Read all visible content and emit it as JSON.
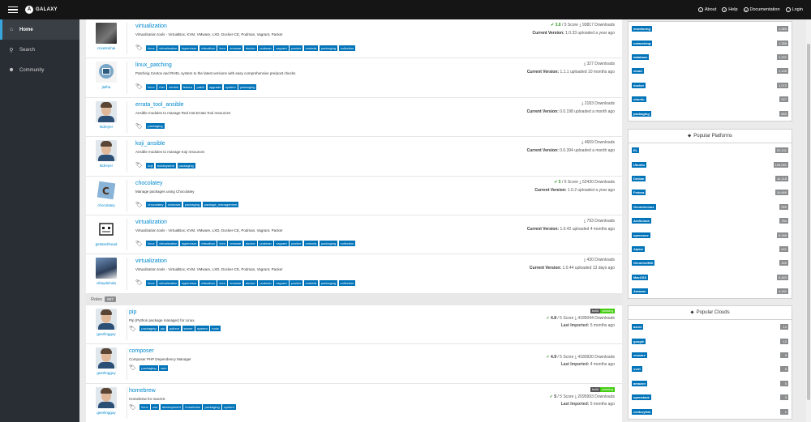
{
  "topbar": {
    "brand": "GALAXY",
    "nav": [
      {
        "label": "About",
        "icon": "info-circle-icon",
        "glyph": "i"
      },
      {
        "label": "Help",
        "icon": "question-circle-icon",
        "glyph": "?"
      },
      {
        "label": "Documentation",
        "icon": "book-icon",
        "glyph": "▭"
      },
      {
        "label": "Login",
        "icon": "login-icon",
        "glyph": "→"
      }
    ]
  },
  "sidebar": {
    "items": [
      {
        "label": "Home",
        "icon": "home-icon",
        "glyph": "⌂"
      },
      {
        "label": "Search",
        "icon": "search-icon",
        "glyph": "⚲"
      },
      {
        "label": "Community",
        "icon": "community-icon",
        "glyph": "☻"
      }
    ]
  },
  "collections": [
    {
      "name": "virtualization",
      "owner": "crivetimihai",
      "desc": "Virtualization tools - VirtualBox, KVM, VMware, LXD, Docker-CE, Podman, Vagrant, Packer",
      "score": "3.8",
      "score_max": "5 Score",
      "downloads": "93817 Downloads",
      "version_label": "Current Version:",
      "version": "1.0.33 uploaded a year ago",
      "tags": [
        "linux",
        "virtualization",
        "hypervisor",
        "virtualbox",
        "kvm",
        "vmware",
        "docker",
        "podman",
        "vagrant",
        "packer",
        "xmlsrds",
        "packaging",
        "collection"
      ],
      "avatar": "dark"
    },
    {
      "name": "linux_patching",
      "owner": "jtalha",
      "desc": "Patching Centos and RHEL system to the latest versions with easy comprehensive pre/post checks",
      "score": "",
      "score_max": "",
      "downloads": "327 Downloads",
      "version_label": "Current Version:",
      "version": "1.1.1 uploaded 10 months ago",
      "tags": [
        "linux",
        "rhel",
        "centos",
        "fedora",
        "patch",
        "upgrade",
        "system",
        "packaging"
      ],
      "avatar": "logo"
    },
    {
      "name": "errata_tool_ansible",
      "owner": "ktdreyer",
      "desc": "Ansible modules to manage Red Hat Errata Tool resources",
      "score": "",
      "score_max": "",
      "downloads": "2183 Downloads",
      "version_label": "Current Version:",
      "version": "0.0.198 uploaded a month ago",
      "tags": [
        "packaging"
      ],
      "avatar": "face"
    },
    {
      "name": "koji_ansible",
      "owner": "ktdreyer",
      "desc": "Ansible modules to manage Koji resources",
      "score": "",
      "score_max": "",
      "downloads": "4669 Downloads",
      "version_label": "Current Version:",
      "version": "0.0.394 uploaded a month ago",
      "tags": [
        "koji",
        "buildsystem",
        "packaging"
      ],
      "avatar": "face"
    },
    {
      "name": "chocolatey",
      "owner": "chocolatey",
      "desc": "Manage packages using Chocolatey",
      "score": "5",
      "score_max": "5 Score",
      "downloads": "62430 Downloads",
      "version_label": "Current Version:",
      "version": "1.0.2 uploaded a year ago",
      "tags": [
        "chocolatey",
        "windows",
        "packaging",
        "package_management"
      ],
      "avatar": "choco"
    },
    {
      "name": "virtualization",
      "owner": "getstackhead",
      "desc": "Virtualization tools - VirtualBox, KVM, VMware, LXD, Docker-CE, Podman, Vagrant, Packer",
      "score": "",
      "score_max": "",
      "downloads": "793 Downloads",
      "version_label": "Current Version:",
      "version": "1.0.42 uploaded 4 months ago",
      "tags": [
        "linux",
        "virtualization",
        "hypervisor",
        "virtualbox",
        "kvm",
        "vmware",
        "docker",
        "podman",
        "vagrant",
        "packer",
        "xmlsrds",
        "packaging",
        "collection"
      ],
      "avatar": "robot"
    },
    {
      "name": "virtualization",
      "owner": "vikaydeloda",
      "desc": "Virtualization tools - VirtualBox, KVM, VMware, LXD, Docker-CE, Podman, Vagrant, Packer",
      "score": "",
      "score_max": "",
      "downloads": "430 Downloads",
      "version_label": "Current Version:",
      "version": "1.0.44 uploaded 13 days ago",
      "tags": [
        "linux",
        "virtualization",
        "hypervisor",
        "virtualbox",
        "kvm",
        "vmware",
        "docker",
        "podman",
        "vagrant",
        "packer",
        "xmlsrds",
        "packaging",
        "collection"
      ],
      "avatar": "scene"
    }
  ],
  "roles_section": {
    "label": "Roles",
    "count": "867"
  },
  "roles": [
    {
      "name": "pip",
      "owner": "geerlingguy",
      "desc": "Pip (Python package manager) for Linux.",
      "score": "4.8",
      "score_max": "5 Score",
      "downloads": "4185044 Downloads",
      "imported_label": "Last Imported:",
      "imported": "5 months ago",
      "badge": true,
      "badge_l": "build",
      "badge_r": "passing",
      "tags": [
        "packaging",
        "pip",
        "python",
        "server",
        "system",
        "tools"
      ]
    },
    {
      "name": "composer",
      "owner": "geerlingguy",
      "desc": "Composer PHP Dependency Manager",
      "score": "4.9",
      "score_max": "5 Score",
      "downloads": "4180930 Downloads",
      "imported_label": "Last Imported:",
      "imported": "4 months ago",
      "badge": false,
      "badge_l": "",
      "badge_r": "",
      "tags": [
        "packaging",
        "web"
      ]
    },
    {
      "name": "homebrew",
      "owner": "geerlingguy",
      "desc": "Homebrew for macOS",
      "score": "5",
      "score_max": "5 Score",
      "downloads": "2095993 Downloads",
      "imported_label": "Last Imported:",
      "imported": "5 months ago",
      "badge": true,
      "badge_l": "build",
      "badge_r": "passing",
      "tags": [
        "linux",
        "osx",
        "development",
        "homebrew",
        "packaging",
        "system"
      ]
    }
  ],
  "tags_panel": {
    "items": [
      {
        "label": "monitoring",
        "count": "1,369"
      },
      {
        "label": "networking",
        "count": "1,358"
      },
      {
        "label": "database",
        "count": "1,201"
      },
      {
        "label": "cloud",
        "count": "1,105"
      },
      {
        "label": "docker",
        "count": "1,072"
      },
      {
        "label": "ubuntu",
        "count": "927"
      },
      {
        "label": "packaging",
        "count": "893"
      }
    ]
  },
  "platforms_panel": {
    "title": "Popular Platforms",
    "items": [
      {
        "label": "EL",
        "count": "22,101"
      },
      {
        "label": "Ubuntu",
        "count": "109,051"
      },
      {
        "label": "Debian",
        "count": "44,118"
      },
      {
        "label": "Fedora",
        "count": "34,669"
      },
      {
        "label": "GenericLinux",
        "count": "959"
      },
      {
        "label": "ArchLinux",
        "count": "784"
      },
      {
        "label": "opensuse",
        "count": "5,346"
      },
      {
        "label": "Alpine",
        "count": "641"
      },
      {
        "label": "GenericUNIX",
        "count": "169"
      },
      {
        "label": "MacOSX",
        "count": "5,483"
      },
      {
        "label": "Amazon",
        "count": "4,161"
      }
    ]
  },
  "clouds_panel": {
    "title": "Popular Clouds",
    "items": [
      {
        "label": "azure",
        "count": "14"
      },
      {
        "label": "google",
        "count": "12"
      },
      {
        "label": "vmware",
        "count": "9"
      },
      {
        "label": "ovirt",
        "count": "8"
      },
      {
        "label": "amazon",
        "count": "5"
      },
      {
        "label": "openstack",
        "count": "3"
      },
      {
        "label": "centurylink",
        "count": "1"
      }
    ]
  }
}
